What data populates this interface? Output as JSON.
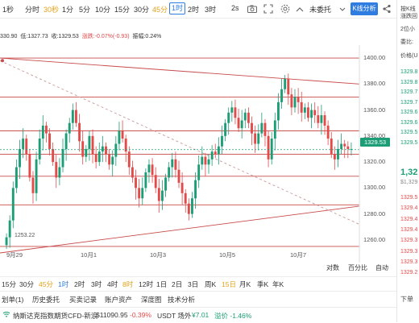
{
  "toolbar": {
    "items": [
      {
        "label": "1秒",
        "state": "normal"
      },
      {
        "label": "分时",
        "state": "normal"
      },
      {
        "label": "30秒",
        "state": "active"
      },
      {
        "label": "1分",
        "state": "normal"
      },
      {
        "label": "5分",
        "state": "normal"
      },
      {
        "label": "10分",
        "state": "normal"
      },
      {
        "label": "15分",
        "state": "normal"
      },
      {
        "label": "30分",
        "state": "normal"
      },
      {
        "label": "45分",
        "state": "active"
      },
      {
        "label": "1时",
        "state": "selected"
      },
      {
        "label": "2时",
        "state": "normal"
      },
      {
        "label": "3时",
        "state": "normal"
      },
      {
        "label": "2s",
        "state": "normal"
      }
    ],
    "account_label": "未委托",
    "kline_button": "K线分析"
  },
  "info": {
    "price_prefix": "330.90",
    "low_label": "低:1327.73",
    "close_label": "收:1329.53",
    "change_label": "涨跌:-0.07%(-0.93)",
    "amplitude_label": "振幅:0.24%"
  },
  "chart_data": {
    "type": "candlestick",
    "price_axis": {
      "min": 1250,
      "max": 1405,
      "ticks": [
        "1400.00",
        "1380.00",
        "1360.00",
        "1340.00",
        "1320.00",
        "1300.00",
        "1280.00",
        "1260.00"
      ]
    },
    "x_ticks": [
      "9月29",
      "10月1",
      "10月3",
      "10月5",
      "10月7"
    ],
    "last_price": "1329.53",
    "low_marker": "1253.22",
    "horizontal_levels": [
      1400,
      1370,
      1344,
      1326,
      1309,
      1287,
      1255
    ],
    "trendlines": {
      "upper": {
        "from": [
          0,
          1400
        ],
        "to": [
          1,
          1380
        ]
      },
      "lower": {
        "from": [
          0,
          1250
        ],
        "to": [
          1,
          1286
        ]
      },
      "dashed": {
        "from": [
          0,
          1398
        ],
        "to": [
          1,
          1272
        ]
      }
    },
    "closes": [
      1262,
      1275,
      1300,
      1316,
      1330,
      1338,
      1326,
      1308,
      1296,
      1322,
      1338,
      1348,
      1342,
      1330,
      1320,
      1308,
      1316,
      1330,
      1342,
      1350,
      1360,
      1350,
      1336,
      1324,
      1330,
      1340,
      1326,
      1320,
      1328,
      1332,
      1326,
      1318,
      1324,
      1334,
      1344,
      1338,
      1328,
      1316,
      1308,
      1300,
      1292,
      1300,
      1312,
      1318,
      1310,
      1300,
      1290,
      1298,
      1308,
      1316,
      1322,
      1314,
      1304,
      1296,
      1288,
      1280,
      1292,
      1306,
      1318,
      1324,
      1318,
      1322,
      1328,
      1326,
      1332,
      1340,
      1350,
      1358,
      1362,
      1354,
      1346,
      1352,
      1358,
      1350,
      1342,
      1334,
      1342,
      1350,
      1340,
      1322,
      1338,
      1352,
      1366,
      1376,
      1384,
      1372,
      1362,
      1370,
      1366,
      1358,
      1362,
      1354,
      1360,
      1356,
      1350,
      1356,
      1348,
      1338,
      1326,
      1322,
      1330,
      1334,
      1332,
      1330,
      1330
    ]
  },
  "controls": {
    "compare": "对数",
    "percent": "百分比",
    "auto": "自动"
  },
  "intervals": [
    {
      "label": "15分",
      "hl": false
    },
    {
      "label": "30分",
      "hl": false
    },
    {
      "label": "45分",
      "hl": true
    },
    {
      "label": "1时",
      "hl": false,
      "sel": true
    },
    {
      "label": "2时",
      "hl": false
    },
    {
      "label": "3时",
      "hl": false
    },
    {
      "label": "4时",
      "hl": false
    },
    {
      "label": "8时",
      "hl": true
    },
    {
      "label": "12时",
      "hl": false
    },
    {
      "label": "1日",
      "hl": false
    },
    {
      "label": "2日",
      "hl": false
    },
    {
      "label": "3日",
      "hl": false
    },
    {
      "label": "周K",
      "hl": false
    },
    {
      "label": "15日",
      "hl": true
    },
    {
      "label": "月K",
      "hl": false
    },
    {
      "label": "季K",
      "hl": false
    },
    {
      "label": "年K",
      "hl": false
    }
  ],
  "tabs": [
    "划单(1)",
    "历史委托",
    "买卖记录",
    "账户资产",
    "深度图",
    "技术分析"
  ],
  "ticker": {
    "left_text": "纳斯达克指数期货CFD-新浪",
    "left_price": "$11090.95",
    "left_change": "-0.39%",
    "mid_text": "USDT 场外",
    "mid_price": "¥7.01",
    "mid_change": "溢价 -1.46%"
  },
  "right_panel": {
    "top_lines": [
      "按K线",
      "涨跌回",
      "2位小"
    ],
    "labels": [
      "委比:",
      "价格(U"
    ],
    "green_prices": [
      "1329.8",
      "1329.8",
      "1329.7",
      "1329.7",
      "1329.6",
      "1329.6",
      "1329.5",
      "1329.5"
    ],
    "last_price": "1,32",
    "sub_price": "$1,329",
    "red_prices": [
      "1329.5",
      "1329.4",
      "1329.4",
      "1329.4",
      "1329.3",
      "1329.3",
      "1329.3",
      "1329.2"
    ],
    "bottom_label": "下单"
  },
  "colors": {
    "up": "#1b9e76",
    "down": "#e34a4a",
    "accent": "#2f7de1",
    "highlight": "#e3a21a",
    "level": "#c84a4a"
  }
}
